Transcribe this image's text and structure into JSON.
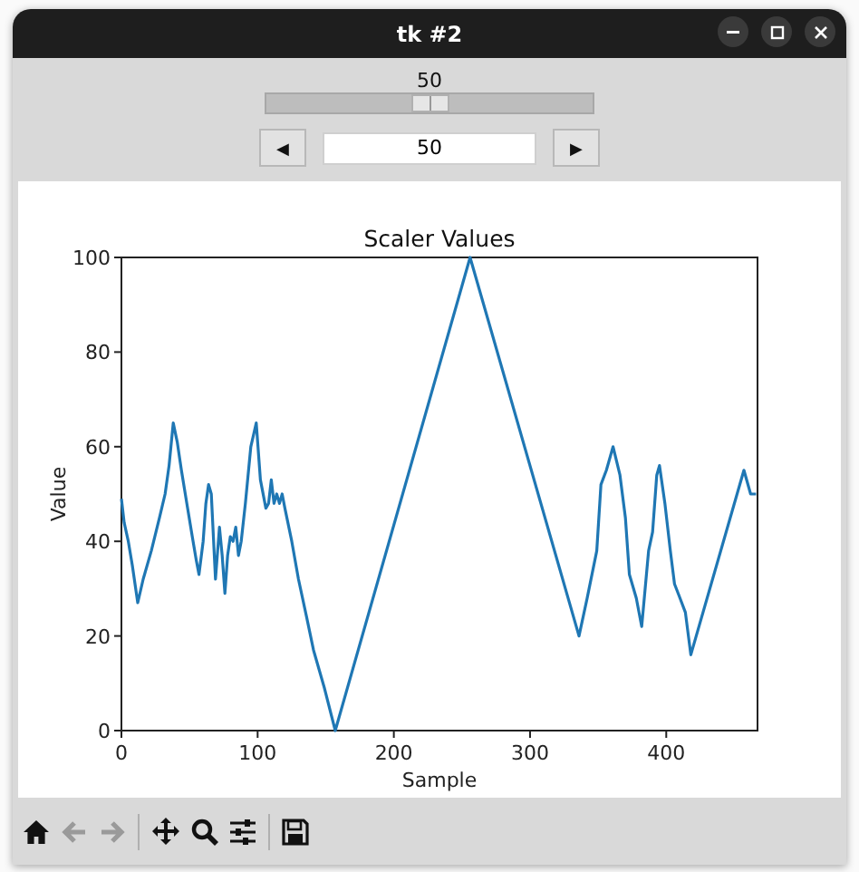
{
  "window": {
    "title": "tk #2"
  },
  "slider": {
    "label": "50",
    "level": 0.5
  },
  "spinbox": {
    "decrement": "◀",
    "value": "50",
    "increment": "▶"
  },
  "figure": {
    "chart_data": {
      "type": "line",
      "title": "Scaler Values",
      "xlabel": "Sample",
      "ylabel": "Value",
      "xlim": [
        0,
        467
      ],
      "ylim": [
        0,
        100
      ],
      "xticks": [
        0,
        100,
        200,
        300,
        400
      ],
      "yticks": [
        0,
        20,
        40,
        60,
        80,
        100
      ],
      "x": [
        0,
        2,
        5,
        8,
        12,
        16,
        22,
        28,
        32,
        35,
        38,
        41,
        44,
        48,
        52,
        55,
        57,
        60,
        62,
        64,
        66,
        69,
        72,
        74,
        76,
        78,
        80,
        82,
        84,
        86,
        88,
        91,
        95,
        99,
        102,
        106,
        108,
        110,
        112,
        114,
        116,
        118,
        120,
        125,
        130,
        136,
        141,
        149,
        157,
        256,
        336,
        342,
        349,
        352,
        356,
        361,
        366,
        370,
        373,
        378,
        382,
        387,
        390,
        393,
        395,
        399,
        403,
        406,
        410,
        414,
        418,
        457,
        462,
        466
      ],
      "series": [
        {
          "color": "#1f77b4",
          "values": [
            49,
            44,
            40,
            35,
            27,
            32,
            38,
            45,
            50,
            56,
            65,
            61,
            55,
            48,
            41,
            36,
            33,
            40,
            48,
            52,
            50,
            32,
            43,
            37,
            29,
            37,
            41,
            40,
            43,
            37,
            40,
            48,
            60,
            65,
            53,
            47,
            48,
            53,
            48,
            50,
            48,
            50,
            47,
            40,
            32,
            24,
            17,
            9,
            0,
            100,
            20,
            28,
            38,
            52,
            55,
            60,
            54,
            45,
            33,
            28,
            22,
            38,
            42,
            54,
            56,
            48,
            38,
            31,
            28,
            25,
            16,
            55,
            50,
            50
          ]
        }
      ]
    }
  },
  "toolbar": [
    {
      "kind": "home",
      "disabled": false
    },
    {
      "kind": "back",
      "disabled": true
    },
    {
      "kind": "forward",
      "disabled": true
    },
    {
      "kind": "separator"
    },
    {
      "kind": "pan",
      "disabled": false
    },
    {
      "kind": "zoom",
      "disabled": false
    },
    {
      "kind": "configure",
      "disabled": false
    },
    {
      "kind": "separator"
    },
    {
      "kind": "save",
      "disabled": false
    }
  ]
}
